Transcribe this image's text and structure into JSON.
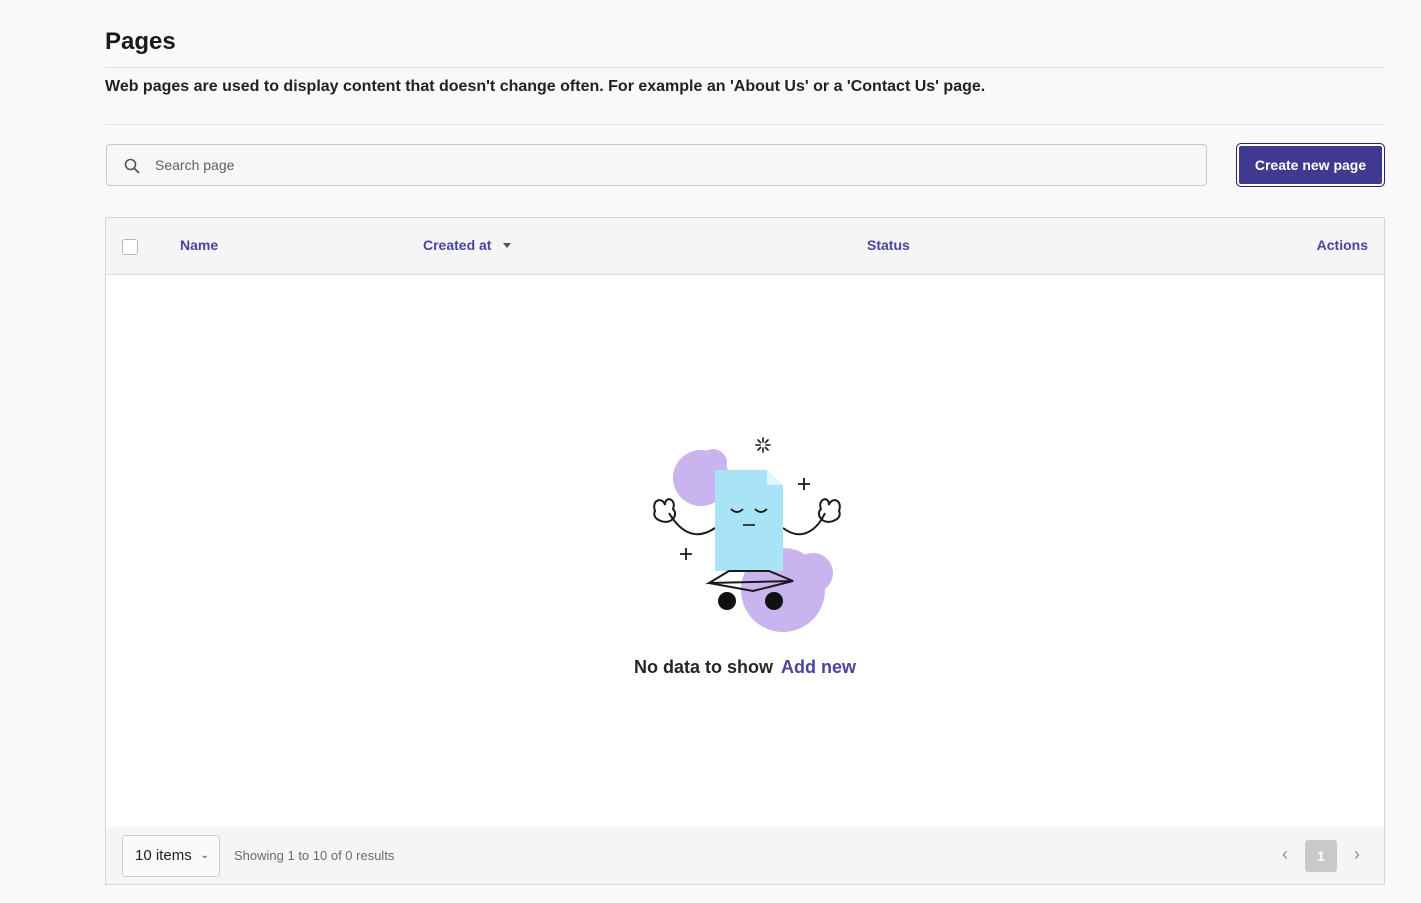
{
  "header": {
    "title": "Pages",
    "description": "Web pages are used to display content that doesn't change often. For example an 'About Us' or a 'Contact Us' page."
  },
  "search": {
    "placeholder": "Search page",
    "value": "",
    "icon": "search-icon"
  },
  "actions": {
    "create_label": "Create new page"
  },
  "table": {
    "columns": [
      "Name",
      "Created at",
      "Status",
      "Actions"
    ],
    "sort": {
      "column": "Created at",
      "direction": "desc"
    },
    "rows": []
  },
  "empty_state": {
    "message": "No data to show",
    "add_label": "Add new"
  },
  "pagination": {
    "per_page_label": "10 items",
    "summary": "Showing 1 to 10 of 0 results",
    "current_page": "1",
    "prev_icon": "chevron-left-icon",
    "next_icon": "chevron-right-icon"
  },
  "colors": {
    "accent": "#4a44a0",
    "button": "#3f3a8f",
    "illustration_doc": "#a8e3f6",
    "illustration_blob": "#c9b4ef"
  }
}
